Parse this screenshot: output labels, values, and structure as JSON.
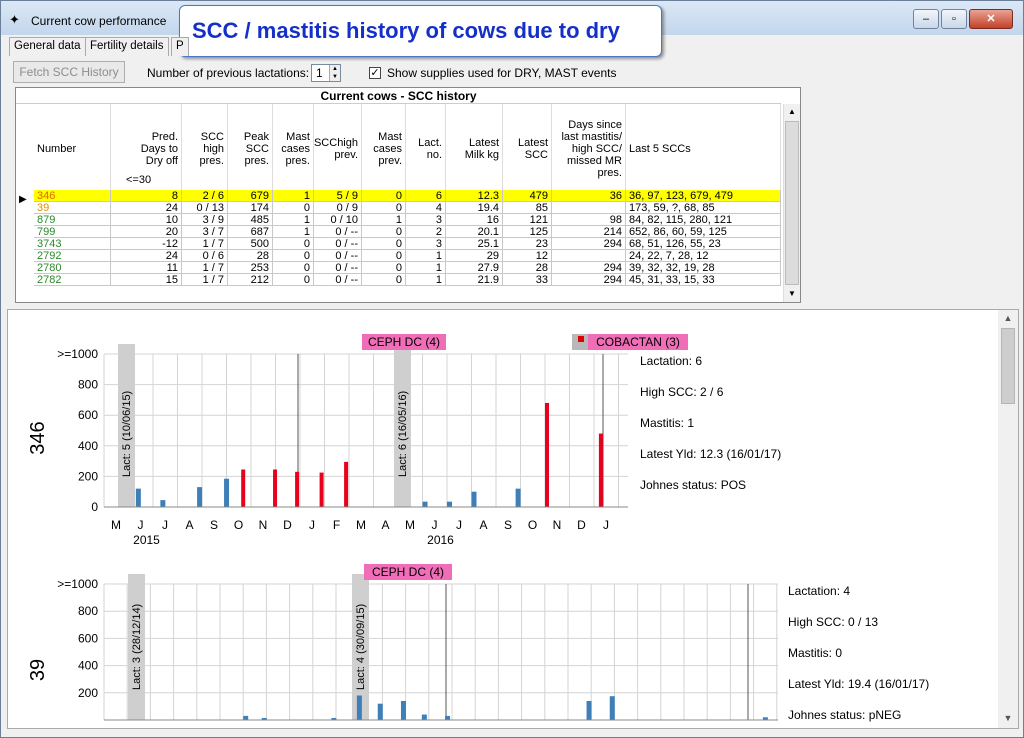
{
  "window": {
    "title": "Current cow performance",
    "icon": "cow-app-icon"
  },
  "banner": "SCC / mastitis history of cows due to dry",
  "tabs": [
    "General data",
    "Fertility details",
    "P"
  ],
  "toolbar": {
    "fetch_label": "Fetch SCC History",
    "lactations_label": "Number of previous lactations:",
    "lactations_value": "1",
    "show_supplies_label": "Show supplies used for DRY, MAST events",
    "show_supplies_checked": true
  },
  "grid": {
    "title": "Current cows - SCC history",
    "filter_note": "<=30",
    "columns": [
      "Number",
      "Pred.\nDays to\nDry off",
      "SCC\nhigh\npres.",
      "Peak\nSCC\npres.",
      "Mast\ncases\npres.",
      "SCChigh\nprev.",
      "Mast\ncases\nprev.",
      "Lact.\nno.",
      "Latest\nMilk kg",
      "Latest\nSCC",
      "Days since\nlast mastitis/\nhigh SCC/\nmissed MR\npres.",
      "Last 5 SCCs"
    ],
    "rows": [
      {
        "number": "346",
        "color": "#e06a00",
        "cells": [
          "8",
          "2 / 6",
          "679",
          "1",
          "5 / 9",
          "0",
          "6",
          "12.3",
          "479",
          "36",
          "36, 97, 123, 679, 479"
        ],
        "selected": true
      },
      {
        "number": "39",
        "color": "#e09000",
        "cells": [
          "24",
          "0 / 13",
          "174",
          "0",
          "0 / 9",
          "0",
          "4",
          "19.4",
          "85",
          "",
          "173, 59, ?, 68, 85"
        ]
      },
      {
        "number": "879",
        "color": "#2a8a2a",
        "cells": [
          "10",
          "3 / 9",
          "485",
          "1",
          "0 / 10",
          "1",
          "3",
          "16",
          "121",
          "98",
          "84, 82, 115, 280, 121"
        ]
      },
      {
        "number": "799",
        "color": "#2a8a2a",
        "cells": [
          "20",
          "3 / 7",
          "687",
          "1",
          "0 / --",
          "0",
          "2",
          "20.1",
          "125",
          "214",
          "652, 86, 60, 59, 125"
        ]
      },
      {
        "number": "3743",
        "color": "#2a8a2a",
        "cells": [
          "-12",
          "1 / 7",
          "500",
          "0",
          "0 / --",
          "0",
          "3",
          "25.1",
          "23",
          "294",
          "68, 51, 126, 55, 23"
        ]
      },
      {
        "number": "2792",
        "color": "#2a8a2a",
        "cells": [
          "24",
          "0 / 6",
          "28",
          "0",
          "0 / --",
          "0",
          "1",
          "29",
          "12",
          "",
          "24, 22, 7, 28, 12"
        ]
      },
      {
        "number": "2780",
        "color": "#2a8a2a",
        "cells": [
          "11",
          "1 / 7",
          "253",
          "0",
          "0 / --",
          "0",
          "1",
          "27.9",
          "28",
          "294",
          "39, 32, 32, 19, 28"
        ]
      },
      {
        "number": "2782",
        "color": "#2a8a2a",
        "cells": [
          "15",
          "1 / 7",
          "212",
          "0",
          "0 / --",
          "0",
          "1",
          "21.9",
          "33",
          "294",
          "45, 31, 33, 15, 33"
        ]
      }
    ]
  },
  "chart_data": [
    {
      "type": "bar",
      "cow_label": "346",
      "yticks": [
        ">=1000",
        "800",
        "600",
        "400",
        "200",
        "0"
      ],
      "ylim": [
        0,
        1000
      ],
      "months": [
        "M",
        "J",
        "J",
        "A",
        "S",
        "O",
        "N",
        "D",
        "J",
        "F",
        "M",
        "A",
        "M",
        "J",
        "J",
        "A",
        "S",
        "O",
        "N",
        "D",
        "J"
      ],
      "years": [
        "2015",
        "2016"
      ],
      "lact_markers": [
        "Lact: 5  (10/06/15)",
        "Lact: 6  (16/05/16)"
      ],
      "events": [
        "CEPH DC (4)",
        "COBACTAN (3)"
      ],
      "bars": [
        {
          "m": 1.3,
          "v": 120,
          "high": false
        },
        {
          "m": 2.3,
          "v": 45,
          "high": false
        },
        {
          "m": 3.8,
          "v": 130,
          "high": false
        },
        {
          "m": 4.9,
          "v": 185,
          "high": false
        },
        {
          "m": 5.6,
          "v": 245,
          "high": true
        },
        {
          "m": 6.9,
          "v": 245,
          "high": true
        },
        {
          "m": 7.8,
          "v": 230,
          "high": true
        },
        {
          "m": 8.8,
          "v": 225,
          "high": true
        },
        {
          "m": 9.8,
          "v": 295,
          "high": true
        },
        {
          "m": 13.0,
          "v": 35,
          "high": false
        },
        {
          "m": 14.0,
          "v": 35,
          "high": false
        },
        {
          "m": 15.0,
          "v": 100,
          "high": false
        },
        {
          "m": 16.8,
          "v": 120,
          "high": false
        },
        {
          "m": 18.0,
          "v": 680,
          "high": true
        },
        {
          "m": 20.2,
          "v": 480,
          "high": true
        }
      ],
      "info": [
        "Lactation: 6",
        "High SCC: 2 / 6",
        "Mastitis: 1",
        "Latest Yld: 12.3 (16/01/17)",
        "Johnes status: POS"
      ]
    },
    {
      "type": "bar",
      "cow_label": "39",
      "yticks": [
        ">=1000",
        "800",
        "600",
        "400",
        "200"
      ],
      "ylim": [
        0,
        1000
      ],
      "lact_markers": [
        "Lact: 3  (28/12/14)",
        "Lact: 4  (30/09/15)"
      ],
      "events": [
        "CEPH DC (4)"
      ],
      "bars": [
        {
          "m": 6.0,
          "v": 30,
          "high": false
        },
        {
          "m": 6.8,
          "v": 10,
          "high": false
        },
        {
          "m": 9.8,
          "v": 5,
          "high": false
        },
        {
          "m": 10.9,
          "v": 180,
          "high": false
        },
        {
          "m": 11.8,
          "v": 120,
          "high": false
        },
        {
          "m": 12.8,
          "v": 140,
          "high": false
        },
        {
          "m": 13.7,
          "v": 40,
          "high": false
        },
        {
          "m": 14.7,
          "v": 30,
          "high": false
        },
        {
          "m": 20.8,
          "v": 140,
          "high": false
        },
        {
          "m": 21.8,
          "v": 175,
          "high": false
        },
        {
          "m": 28.4,
          "v": 20,
          "high": false
        }
      ],
      "info": [
        "Lactation: 4",
        "High SCC: 0 / 13",
        "Mastitis: 0",
        "Latest Yld: 19.4 (16/01/17)",
        "Johnes status: pNEG"
      ]
    }
  ]
}
